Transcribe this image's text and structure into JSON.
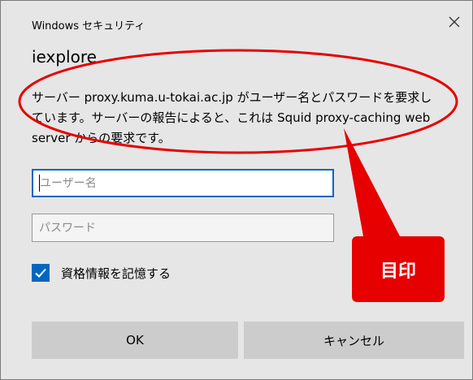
{
  "dialog": {
    "window_title": "Windows セキュリティ",
    "app_name": "iexplore",
    "message_lines": [
      "サーバー proxy.kuma.u-tokai.ac.jp がユーザー名とパスワードを要求し",
      "ています。サーバーの報告によると、これは Squid proxy-caching web",
      "server からの要求です。"
    ],
    "username": {
      "value": "",
      "placeholder": "ユーザー名"
    },
    "password": {
      "value": "",
      "placeholder": "パスワード"
    },
    "remember": {
      "label": "資格情報を記憶する",
      "checked": true
    },
    "ok_label": "OK",
    "cancel_label": "キャンセル",
    "icons": {
      "close": "close-icon",
      "check": "checkmark-icon"
    },
    "accent_color": "#0067c0"
  },
  "annotation": {
    "callout_label": "目印",
    "color": "#e60000"
  }
}
